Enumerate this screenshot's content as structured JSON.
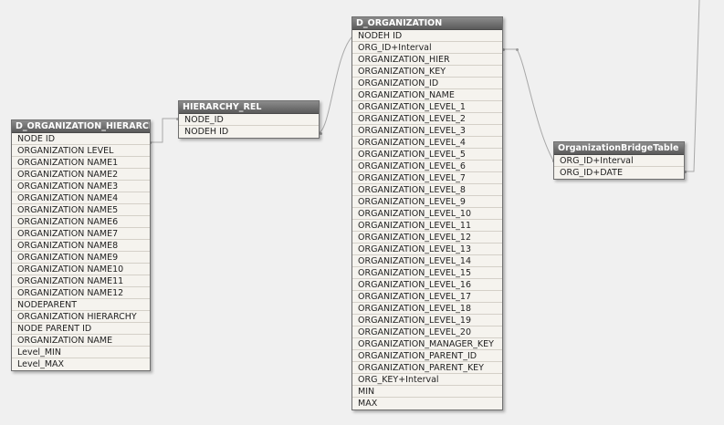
{
  "tables": {
    "d_org_hier": {
      "title": "D_ORGANIZATION_HIERARCHY",
      "fields": [
        "NODE ID",
        "ORGANIZATION LEVEL",
        "ORGANIZATION NAME1",
        "ORGANIZATION NAME2",
        "ORGANIZATION NAME3",
        "ORGANIZATION NAME4",
        "ORGANIZATION NAME5",
        "ORGANIZATION NAME6",
        "ORGANIZATION NAME7",
        "ORGANIZATION NAME8",
        "ORGANIZATION NAME9",
        "ORGANIZATION NAME10",
        "ORGANIZATION NAME11",
        "ORGANIZATION NAME12",
        "NODEPARENT",
        "ORGANIZATION HIERARCHY",
        "NODE PARENT ID",
        "ORGANIZATION NAME",
        "Level_MIN",
        "Level_MAX"
      ]
    },
    "hierarchy_rel": {
      "title": "HIERARCHY_REL",
      "fields": [
        "NODE_ID",
        "NODEH ID"
      ]
    },
    "d_organization": {
      "title": "D_ORGANIZATION",
      "fields": [
        "NODEH ID",
        "ORG_ID+Interval",
        "ORGANIZATION_HIER",
        "ORGANIZATION_KEY",
        "ORGANIZATION_ID",
        "ORGANIZATION_NAME",
        "ORGANIZATION_LEVEL_1",
        "ORGANIZATION_LEVEL_2",
        "ORGANIZATION_LEVEL_3",
        "ORGANIZATION_LEVEL_4",
        "ORGANIZATION_LEVEL_5",
        "ORGANIZATION_LEVEL_6",
        "ORGANIZATION_LEVEL_7",
        "ORGANIZATION_LEVEL_8",
        "ORGANIZATION_LEVEL_9",
        "ORGANIZATION_LEVEL_10",
        "ORGANIZATION_LEVEL_11",
        "ORGANIZATION_LEVEL_12",
        "ORGANIZATION_LEVEL_13",
        "ORGANIZATION_LEVEL_14",
        "ORGANIZATION_LEVEL_15",
        "ORGANIZATION_LEVEL_16",
        "ORGANIZATION_LEVEL_17",
        "ORGANIZATION_LEVEL_18",
        "ORGANIZATION_LEVEL_19",
        "ORGANIZATION_LEVEL_20",
        "ORGANIZATION_MANAGER_KEY",
        "ORGANIZATION_PARENT_ID",
        "ORGANIZATION_PARENT_KEY",
        "ORG_KEY+Interval",
        "MIN",
        "MAX"
      ]
    },
    "org_bridge": {
      "title": "OrganizationBridgeTable",
      "fields": [
        "ORG_ID+Interval",
        "ORG_ID+DATE"
      ]
    }
  },
  "colors": {
    "background": "#f0f0f0",
    "header": "#6e6e6e",
    "body": "#f5f3ee",
    "link": "#a8a8a8"
  }
}
